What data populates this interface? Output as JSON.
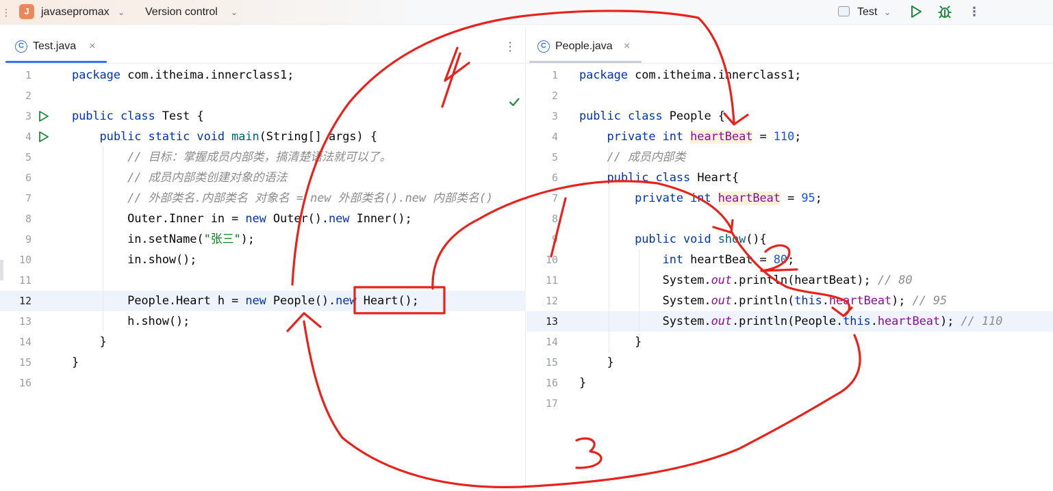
{
  "toolbar": {
    "project_initial": "J",
    "project_name": "javasepromax",
    "version_control": "Version control",
    "run_config": "Test"
  },
  "left": {
    "tab_label": "Test.java",
    "line_numbers": [
      "1",
      "2",
      "3",
      "4",
      "5",
      "6",
      "7",
      "8",
      "9",
      "10",
      "11",
      "12",
      "13",
      "14",
      "15",
      "16"
    ],
    "code": [
      [
        [
          "kw",
          "package "
        ],
        [
          "",
          "com.itheima.innerclass1;"
        ]
      ],
      [],
      [
        [
          "kw",
          "public class "
        ],
        [
          "",
          "Test {"
        ]
      ],
      [
        [
          "",
          "    "
        ],
        [
          "kw",
          "public static void "
        ],
        [
          "fn",
          "main"
        ],
        [
          "",
          "(String[] args) {"
        ]
      ],
      [
        [
          "",
          "        "
        ],
        [
          "cm",
          "// 目标：掌握成员内部类，搞清楚语法就可以了。"
        ]
      ],
      [
        [
          "",
          "        "
        ],
        [
          "cm",
          "// 成员内部类创建对象的语法"
        ]
      ],
      [
        [
          "",
          "        "
        ],
        [
          "cm",
          "// 外部类名.内部类名 对象名 = new 外部类名().new 内部类名()"
        ]
      ],
      [
        [
          "",
          "        Outer.Inner in = "
        ],
        [
          "kw",
          "new "
        ],
        [
          "",
          "Outer()."
        ],
        [
          "kw",
          "new "
        ],
        [
          "",
          "Inner();"
        ]
      ],
      [
        [
          "",
          "        in.setName("
        ],
        [
          "st",
          "\"张三\""
        ],
        [
          "",
          ");"
        ]
      ],
      [
        [
          "",
          "        in.show();"
        ]
      ],
      [],
      [
        [
          "",
          "        People.Heart h = "
        ],
        [
          "kw",
          "new "
        ],
        [
          "",
          "People()."
        ],
        [
          "kw",
          "new "
        ],
        [
          "",
          "Heart();"
        ]
      ],
      [
        [
          "",
          "        h.show();"
        ]
      ],
      [
        [
          "",
          "    }"
        ]
      ],
      [
        [
          "",
          "}"
        ]
      ],
      []
    ]
  },
  "right": {
    "tab_label": "People.java",
    "line_numbers": [
      "1",
      "2",
      "3",
      "4",
      "5",
      "6",
      "7",
      "8",
      "9",
      "10",
      "11",
      "12",
      "13",
      "14",
      "15",
      "16",
      "17"
    ],
    "code": [
      [
        [
          "kw",
          "package "
        ],
        [
          "",
          "com.itheima.innerclass1;"
        ]
      ],
      [],
      [
        [
          "kw",
          "public class "
        ],
        [
          "",
          "People {"
        ]
      ],
      [
        [
          "",
          "    "
        ],
        [
          "kw",
          "private int "
        ],
        [
          "fldhl",
          "heartBeat"
        ],
        [
          "",
          " = "
        ],
        [
          "num",
          "110"
        ],
        [
          "",
          ";"
        ]
      ],
      [
        [
          "",
          "    "
        ],
        [
          "cm",
          "// 成员内部类"
        ]
      ],
      [
        [
          "",
          "    "
        ],
        [
          "kw",
          "public class "
        ],
        [
          "",
          "Heart{"
        ]
      ],
      [
        [
          "",
          "        "
        ],
        [
          "kw",
          "private int "
        ],
        [
          "fldhl",
          "heartBeat"
        ],
        [
          "",
          " = "
        ],
        [
          "num",
          "95"
        ],
        [
          "",
          ";"
        ]
      ],
      [],
      [
        [
          "",
          "        "
        ],
        [
          "kw",
          "public void "
        ],
        [
          "fn",
          "show"
        ],
        [
          "",
          "(){"
        ]
      ],
      [
        [
          "",
          "            "
        ],
        [
          "kw",
          "int "
        ],
        [
          "",
          "heartBeat = "
        ],
        [
          "num",
          "80"
        ],
        [
          "",
          ";"
        ]
      ],
      [
        [
          "",
          "            System."
        ],
        [
          "stat",
          "out"
        ],
        [
          "",
          ".println(heartBeat); "
        ],
        [
          "cm",
          "// 80"
        ]
      ],
      [
        [
          "",
          "            System."
        ],
        [
          "stat",
          "out"
        ],
        [
          "",
          ".println("
        ],
        [
          "kw",
          "this"
        ],
        [
          "",
          "."
        ],
        [
          "fld",
          "heartBeat"
        ],
        [
          "",
          "); "
        ],
        [
          "cm",
          "// 95"
        ]
      ],
      [
        [
          "",
          "            System."
        ],
        [
          "stat",
          "out"
        ],
        [
          "",
          ".println(People."
        ],
        [
          "kw",
          "this"
        ],
        [
          "",
          "."
        ],
        [
          "fld",
          "heartBeat"
        ],
        [
          "",
          "); "
        ],
        [
          "cm",
          "// 110"
        ]
      ],
      [
        [
          "",
          "        }"
        ]
      ],
      [
        [
          "",
          "    }"
        ]
      ],
      [
        [
          "",
          "}"
        ]
      ],
      []
    ]
  },
  "annotations": {
    "step_labels": [
      "4",
      "2",
      "3"
    ]
  },
  "colors": {
    "keyword": "#0033b3",
    "comment": "#8c8c8c",
    "string": "#067d17",
    "number": "#1750eb",
    "field": "#871094",
    "annotation_red": "#e8211b",
    "accent": "#3574f0"
  }
}
